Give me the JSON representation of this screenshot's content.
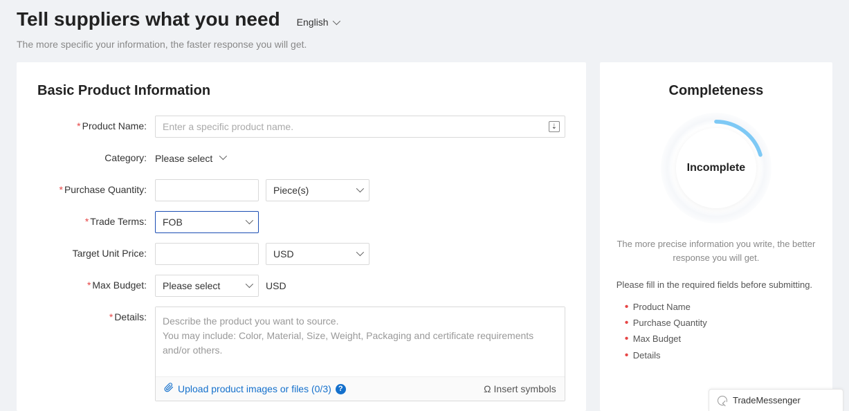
{
  "header": {
    "title": "Tell suppliers what you need",
    "language": "English",
    "subtitle": "The more specific your information, the faster response you will get."
  },
  "form": {
    "section_title": "Basic Product Information",
    "product_name": {
      "label": "Product Name:",
      "placeholder": "Enter a specific product name."
    },
    "category": {
      "label": "Category:",
      "value": "Please select"
    },
    "purchase_qty": {
      "label": "Purchase Quantity:",
      "unit": "Piece(s)"
    },
    "trade_terms": {
      "label": "Trade Terms:",
      "value": "FOB"
    },
    "target_price": {
      "label": "Target Unit Price:",
      "currency": "USD"
    },
    "max_budget": {
      "label": "Max Budget:",
      "value": "Please select",
      "currency": "USD"
    },
    "details": {
      "label": "Details:",
      "placeholder": "Describe the product you want to source.\nYou may include: Color, Material, Size, Weight, Packaging and certificate requirements and/or others.",
      "upload_text": "Upload product images or files (0/3)",
      "insert_symbols": "Ω Insert symbols"
    }
  },
  "sidebar": {
    "title": "Completeness",
    "status": "Incomplete",
    "desc": "The more precise information you write, the better response you will get.",
    "note": "Please fill in the required fields before submitting.",
    "required": [
      "Product Name",
      "Purchase Quantity",
      "Max Budget",
      "Details"
    ]
  },
  "messenger": {
    "label": "TradeMessenger"
  }
}
